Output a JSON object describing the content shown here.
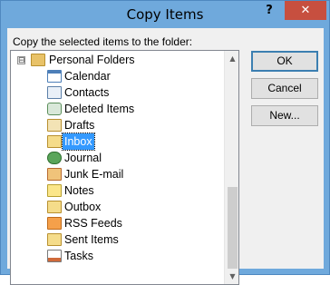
{
  "dialog": {
    "title": "Copy Items",
    "help_label": "?",
    "close_label": "✕",
    "prompt": "Copy the selected items to the folder:"
  },
  "tree": {
    "root": {
      "label": "Personal Folders",
      "expander": "⊟",
      "icon": "personal-folders-icon"
    },
    "items": [
      {
        "label": "Calendar",
        "icon": "calendar-icon",
        "selected": false
      },
      {
        "label": "Contacts",
        "icon": "contacts-icon",
        "selected": false
      },
      {
        "label": "Deleted Items",
        "icon": "deleted-items-icon",
        "selected": false
      },
      {
        "label": "Drafts",
        "icon": "drafts-icon",
        "selected": false
      },
      {
        "label": "Inbox",
        "icon": "inbox-icon",
        "selected": true
      },
      {
        "label": "Journal",
        "icon": "journal-icon",
        "selected": false
      },
      {
        "label": "Junk E-mail",
        "icon": "junk-email-icon",
        "selected": false
      },
      {
        "label": "Notes",
        "icon": "notes-icon",
        "selected": false
      },
      {
        "label": "Outbox",
        "icon": "outbox-icon",
        "selected": false
      },
      {
        "label": "RSS Feeds",
        "icon": "rss-feeds-icon",
        "selected": false
      },
      {
        "label": "Sent Items",
        "icon": "sent-items-icon",
        "selected": false
      },
      {
        "label": "Tasks",
        "icon": "tasks-icon",
        "selected": false
      }
    ]
  },
  "buttons": {
    "ok": "OK",
    "cancel": "Cancel",
    "new": "New..."
  },
  "colors": {
    "titlebar": "#6fa9dc",
    "close": "#c74f3f",
    "selection": "#3399ff"
  }
}
